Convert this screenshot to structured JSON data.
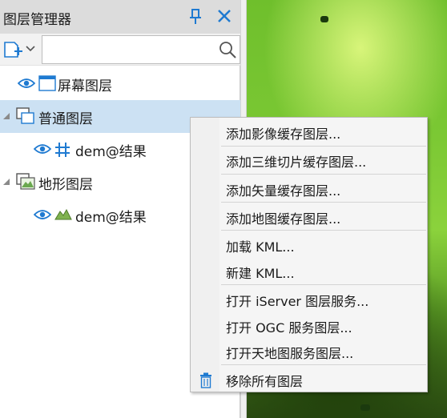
{
  "panel": {
    "title": "图层管理器",
    "search_placeholder": ""
  },
  "tree": {
    "screen_layer": "屏幕图层",
    "normal_layer": "普通图层",
    "normal_child": "dem@结果",
    "terrain_layer": "地形图层",
    "terrain_child": "dem@结果"
  },
  "menu": {
    "items": [
      "添加影像缓存图层...",
      "添加三维切片缓存图层...",
      "添加矢量缓存图层...",
      "添加地图缓存图层...",
      "加载 KML...",
      "新建 KML...",
      "打开 iServer 图层服务...",
      "打开 OGC 服务图层...",
      "打开天地图服务图层...",
      "移除所有图层"
    ]
  },
  "colors": {
    "accent": "#1f7ad1",
    "selection": "#cce1f3"
  }
}
